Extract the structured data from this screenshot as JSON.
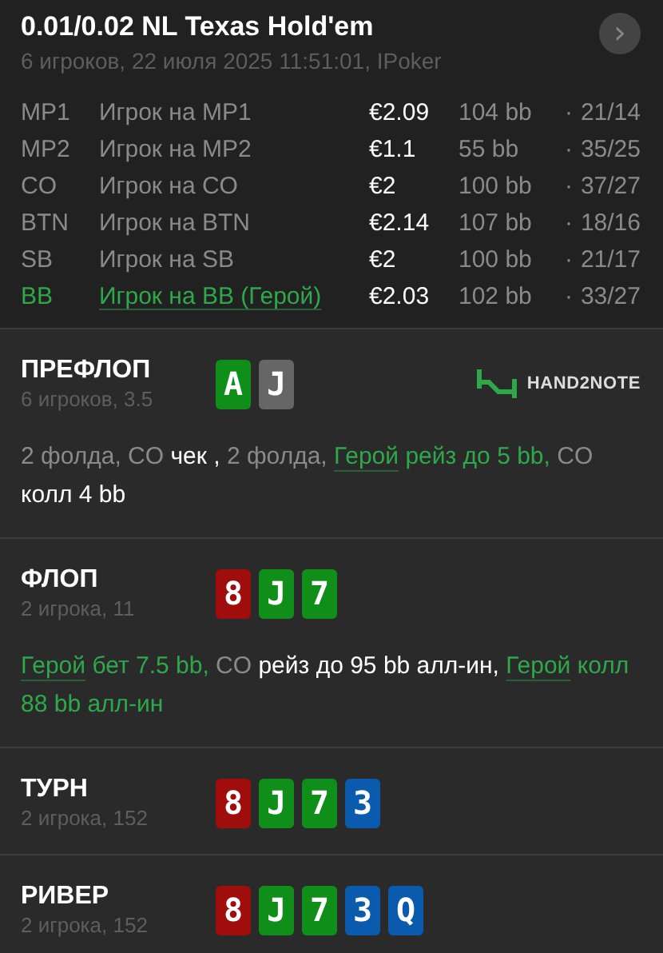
{
  "header": {
    "title": "0.01/0.02 NL Texas Hold'em",
    "subtitle": "6 игроков, 22 июля 2025 11:51:01, IPoker",
    "next_button": {
      "label": "›"
    }
  },
  "players": [
    {
      "position": "MP1",
      "name": "Игрок на MP1",
      "stack": "€2.09",
      "bb": "104 bb",
      "separator": "·",
      "stats": "21/14",
      "hero": false
    },
    {
      "position": "MP2",
      "name": "Игрок на MP2",
      "stack": "€1.1",
      "bb": "55 bb",
      "separator": "·",
      "stats": "35/25",
      "hero": false
    },
    {
      "position": "CO",
      "name": "Игрок на CO",
      "stack": "€2",
      "bb": "100 bb",
      "separator": "·",
      "stats": "37/27",
      "hero": false
    },
    {
      "position": "BTN",
      "name": "Игрок на BTN",
      "stack": "€2.14",
      "bb": "107 bb",
      "separator": "·",
      "stats": "18/16",
      "hero": false
    },
    {
      "position": "SB",
      "name": "Игрок на SB",
      "stack": "€2",
      "bb": "100 bb",
      "separator": "·",
      "stats": "21/17",
      "hero": false
    },
    {
      "position": "BB",
      "name": "Игрок на BB (Герой)",
      "stack": "€2.03",
      "bb": "102 bb",
      "separator": "·",
      "stats": "33/27",
      "hero": true
    }
  ],
  "streets": [
    {
      "name": "ПРЕФЛОП",
      "info": "6 игроков, 3.5",
      "logo": {
        "text": "HAND2NOTE"
      },
      "cards": [
        {
          "rank": "A",
          "color": "#0f8f1a"
        },
        {
          "rank": "J",
          "color": "#666666"
        }
      ],
      "actions": [
        {
          "kind": "muted",
          "text": "2 фолда, CO "
        },
        {
          "kind": "white",
          "text": "чек , "
        },
        {
          "kind": "muted",
          "text": "2 фолда, "
        },
        {
          "kind": "hero",
          "text": "Герой"
        },
        {
          "kind": "green",
          "text": " рейз до 5 bb, "
        },
        {
          "kind": "muted",
          "text": "CO "
        },
        {
          "kind": "white",
          "text": "колл 4 bb"
        }
      ]
    },
    {
      "name": "ФЛОП",
      "info": "2 игрока, 11",
      "cards": [
        {
          "rank": "8",
          "color": "#a00d0d"
        },
        {
          "rank": "J",
          "color": "#0f8f1a"
        },
        {
          "rank": "7",
          "color": "#0f8f1a"
        }
      ],
      "actions": [
        {
          "kind": "hero",
          "text": "Герой"
        },
        {
          "kind": "green",
          "text": " бет 7.5 bb, "
        },
        {
          "kind": "muted",
          "text": "CO "
        },
        {
          "kind": "white",
          "text": "рейз до 95 bb алл-ин, "
        },
        {
          "kind": "hero",
          "text": "Герой"
        },
        {
          "kind": "green",
          "text": " колл 88 bb алл-ин"
        }
      ]
    },
    {
      "name": "ТУРН",
      "info": "2 игрока, 152",
      "cards": [
        {
          "rank": "8",
          "color": "#a00d0d"
        },
        {
          "rank": "J",
          "color": "#0f8f1a"
        },
        {
          "rank": "7",
          "color": "#0f8f1a"
        },
        {
          "rank": "3",
          "color": "#0a5aad"
        }
      ]
    },
    {
      "name": "РИВЕР",
      "info": "2 игрока, 152",
      "cards": [
        {
          "rank": "8",
          "color": "#a00d0d"
        },
        {
          "rank": "J",
          "color": "#0f8f1a"
        },
        {
          "rank": "7",
          "color": "#0f8f1a"
        },
        {
          "rank": "3",
          "color": "#0a5aad"
        },
        {
          "rank": "Q",
          "color": "#0a5aad"
        }
      ]
    }
  ]
}
